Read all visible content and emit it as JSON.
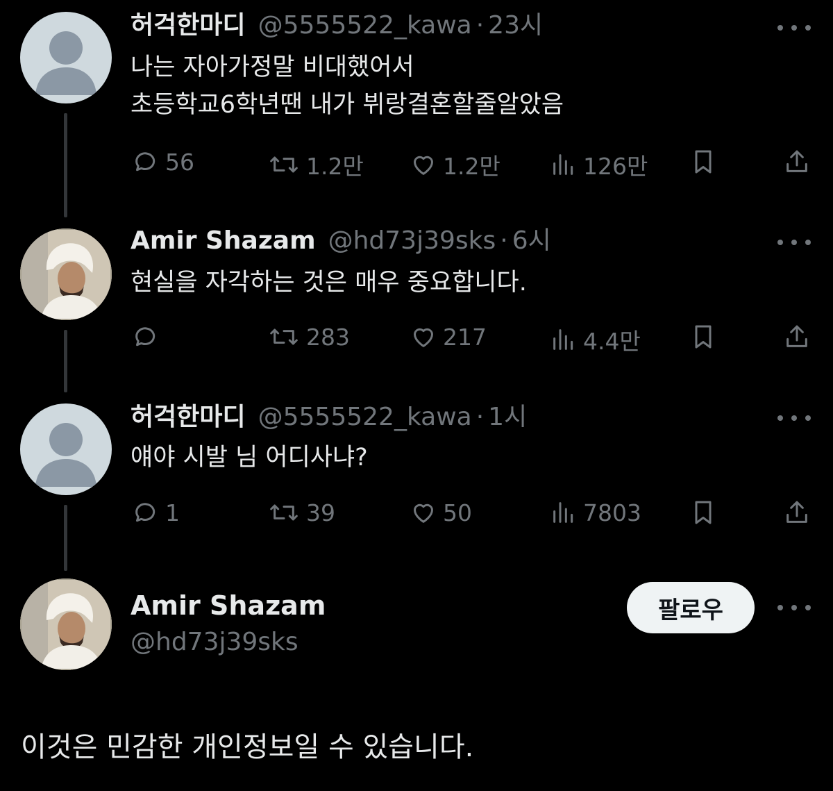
{
  "tweets": [
    {
      "name": "허걱한마디",
      "handle": "@5555522_kawa",
      "time": "23시",
      "lines": [
        "나는 자아가정말 비대했어서",
        "초등학교6학년땐 내가 뷔랑결혼할줄알았음"
      ],
      "replies": "56",
      "retweets": "1.2만",
      "likes": "1.2만",
      "views": "126만"
    },
    {
      "name": "Amir Shazam",
      "handle": "@hd73j39sks",
      "time": "6시",
      "lines": [
        "현실을 자각하는 것은 매우 중요합니다."
      ],
      "replies": "",
      "retweets": "283",
      "likes": "217",
      "views": "4.4만"
    },
    {
      "name": "허걱한마디",
      "handle": "@5555522_kawa",
      "time": "1시",
      "lines": [
        "얘야 시발 님 어디사냐?"
      ],
      "replies": "1",
      "retweets": "39",
      "likes": "50",
      "views": "7803"
    }
  ],
  "separator": "·",
  "profile": {
    "name": "Amir Shazam",
    "handle": "@hd73j39sks",
    "follow_label": "팔로우"
  },
  "notice": "이것은 민감한 개인정보일 수 있습니다.",
  "icons": {
    "reply": "reply-icon",
    "retweet": "retweet-icon",
    "like": "heart-icon",
    "views": "views-icon",
    "bookmark": "bookmark-icon",
    "share": "share-icon",
    "more": "more-icon"
  },
  "colors": {
    "background": "#000000",
    "text": "#e7e9ea",
    "muted": "#71767b",
    "button_bg": "#eff3f4",
    "button_text": "#0f1419",
    "default_avatar": "#cfd9de"
  }
}
